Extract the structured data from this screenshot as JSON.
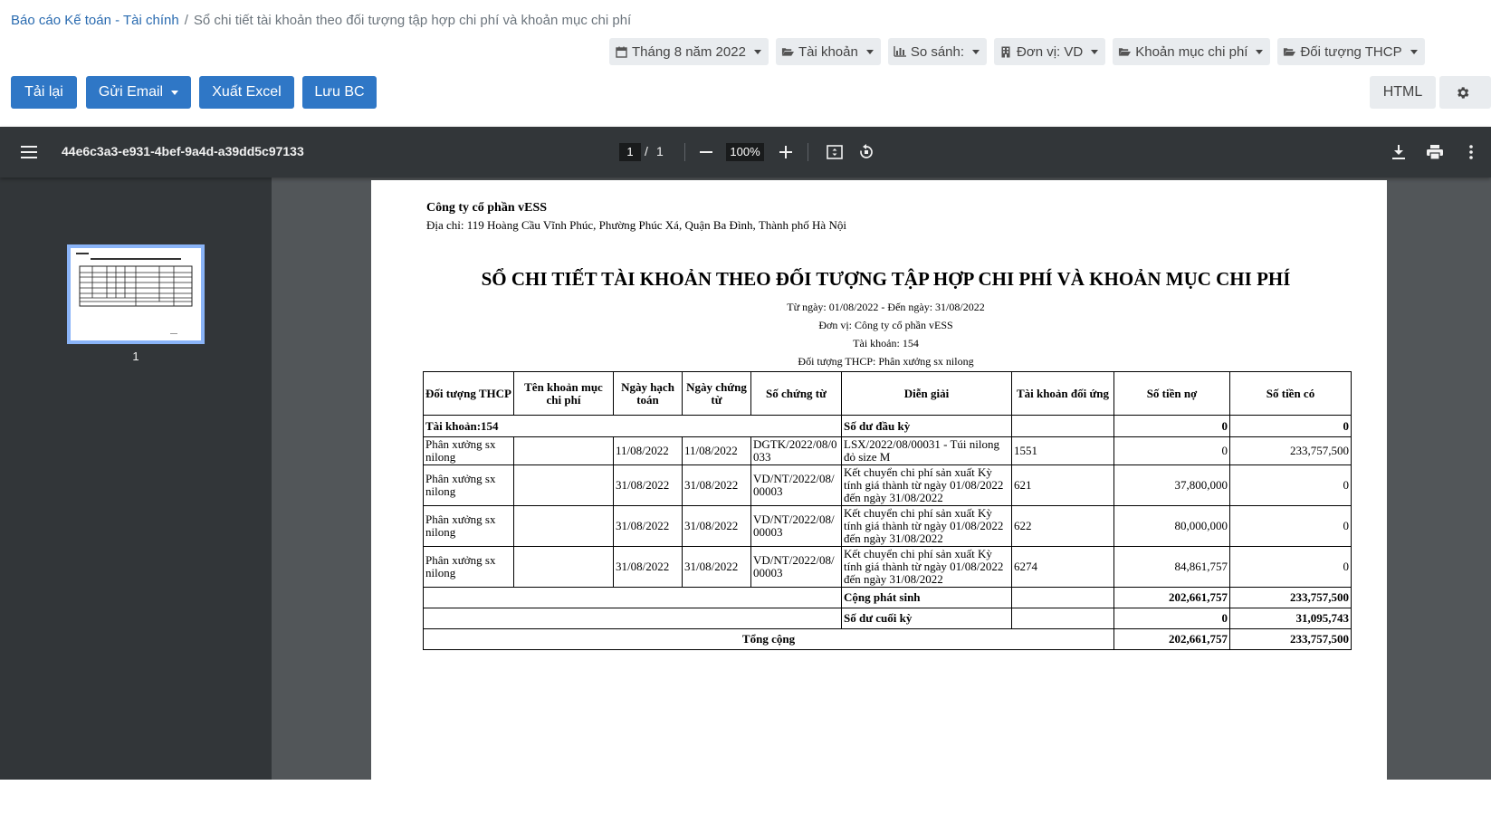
{
  "breadcrumb": {
    "root": "Báo cáo Kế toán - Tài chính",
    "separator": "/",
    "current": "Sổ chi tiết tài khoản theo đối tượng tập hợp chi phí và khoản mục chi phí"
  },
  "filters": [
    {
      "label": "Tháng 8 năm 2022",
      "icon": "calendar-icon"
    },
    {
      "label": "Tài khoản",
      "icon": "folder-open-icon"
    },
    {
      "label": "So sánh:",
      "icon": "bar-chart-icon"
    },
    {
      "label": "Đơn vị: VD",
      "icon": "building-icon"
    },
    {
      "label": "Khoản mục chi phí",
      "icon": "folder-open-icon"
    },
    {
      "label": "Đối tượng THCP",
      "icon": "folder-open-icon"
    }
  ],
  "actions": {
    "reload": "Tải lại",
    "email": "Gửi Email",
    "excel": "Xuất Excel",
    "save": "Lưu BC",
    "html": "HTML",
    "settings_icon": "gear-icon"
  },
  "viewer": {
    "doc_title": "44e6c3a3-e931-4bef-9a4d-a39dd5c97133",
    "page_current": "1",
    "page_sep": "/",
    "page_total": "1",
    "zoom": "100%",
    "thumb_label": "1"
  },
  "report": {
    "company": "Công ty cổ phần vESS",
    "address": "Địa chỉ: 119 Hoàng Cầu Vĩnh Phúc, Phường Phúc Xá, Quận Ba Đình, Thành phố Hà Nội",
    "title": "SỔ CHI TIẾT TÀI KHOẢN THEO ĐỐI TƯỢNG TẬP HỢP CHI PHÍ VÀ KHOẢN MỤC CHI PHÍ",
    "period": "Từ ngày: 01/08/2022 - Đến ngày: 31/08/2022",
    "unit": "Đơn vị: Công ty cổ phần vESS",
    "account": "Tài khoản: 154",
    "object": "Đối tượng THCP: Phân xưởng sx nilong",
    "headers": [
      "Đối tượng THCP",
      "Tên khoản mục chi phí",
      "Ngày hạch toán",
      "Ngày chứng từ",
      "Số chứng từ",
      "Diễn giải",
      "Tài khoản đối ứng",
      "Số tiền nợ",
      "Số tiền có"
    ],
    "opening": {
      "account_label": "Tài khoản:154",
      "label": "Số dư đầu kỳ",
      "debit": "0",
      "credit": "0"
    },
    "rows": [
      {
        "object": "Phân xưởng sx nilong",
        "item": "",
        "post_date": "11/08/2022",
        "doc_date": "11/08/2022",
        "doc_no": "DGTK/2022/08/0033",
        "desc": "LSX/2022/08/00031 - Túi nilong đỏ size M",
        "contra": "1551",
        "debit": "0",
        "credit": "233,757,500"
      },
      {
        "object": "Phân xưởng sx nilong",
        "item": "",
        "post_date": "31/08/2022",
        "doc_date": "31/08/2022",
        "doc_no": "VD/NT/2022/08/00003",
        "desc": "Kết chuyển chi phí sản xuất Kỳ tính giá thành từ ngày 01/08/2022 đến ngày 31/08/2022",
        "contra": "621",
        "debit": "37,800,000",
        "credit": "0"
      },
      {
        "object": "Phân xưởng sx nilong",
        "item": "",
        "post_date": "31/08/2022",
        "doc_date": "31/08/2022",
        "doc_no": "VD/NT/2022/08/00003",
        "desc": "Kết chuyển chi phí sản xuất Kỳ tính giá thành từ ngày 01/08/2022 đến ngày 31/08/2022",
        "contra": "622",
        "debit": "80,000,000",
        "credit": "0"
      },
      {
        "object": "Phân xưởng sx nilong",
        "item": "",
        "post_date": "31/08/2022",
        "doc_date": "31/08/2022",
        "doc_no": "VD/NT/2022/08/00003",
        "desc": "Kết chuyển chi phí sản xuất Kỳ tính giá thành từ ngày 01/08/2022 đến ngày 31/08/2022",
        "contra": "6274",
        "debit": "84,861,757",
        "credit": "0"
      }
    ],
    "period_total": {
      "label": "Cộng phát sinh",
      "debit": "202,661,757",
      "credit": "233,757,500"
    },
    "closing": {
      "label": "Số dư cuối kỳ",
      "debit": "0",
      "credit": "31,095,743"
    },
    "grand_total": {
      "label": "Tổng cộng",
      "debit": "202,661,757",
      "credit": "233,757,500"
    }
  }
}
